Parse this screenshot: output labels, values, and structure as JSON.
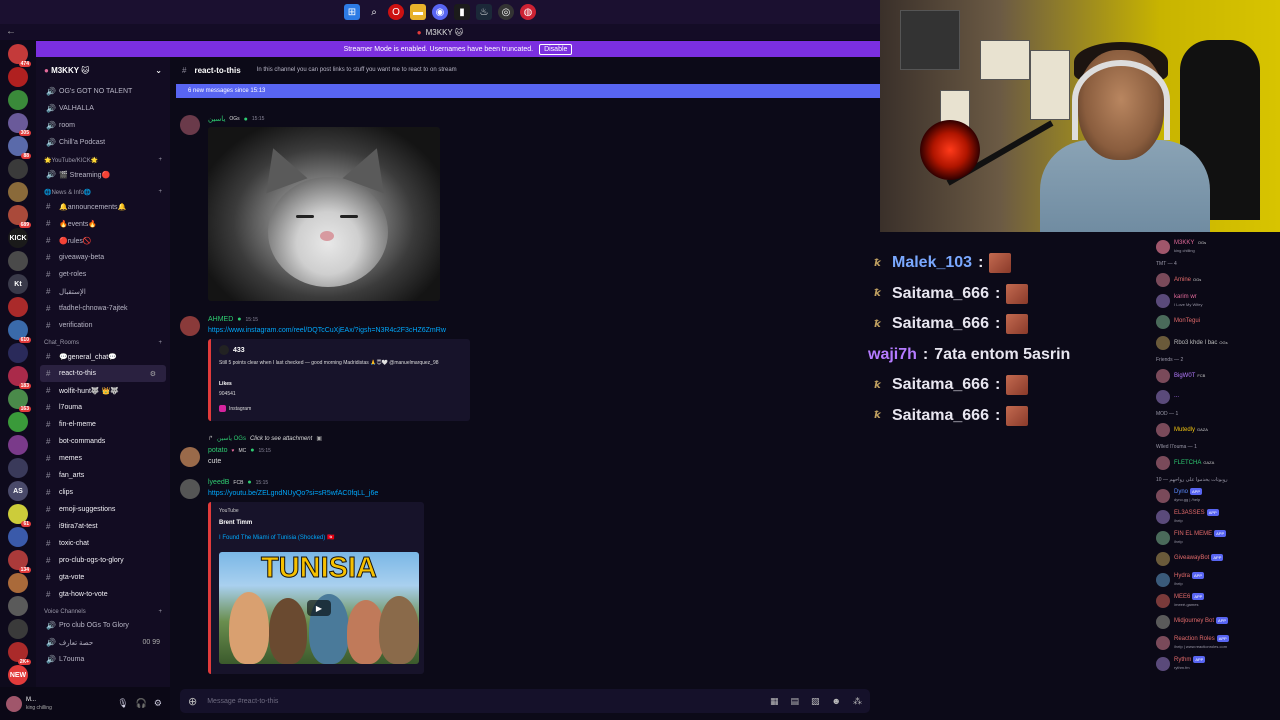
{
  "os_taskbar": {
    "icons": [
      "windows-icon",
      "search-icon",
      "opera-icon",
      "folder-icon",
      "discord-icon",
      "app-icon",
      "steam-icon",
      "app2-icon",
      "chrome-icon"
    ]
  },
  "window": {
    "title": "M3KKY 🐱"
  },
  "streamer_banner": {
    "text": "Streamer Mode is enabled. Usernames have been truncated.",
    "button": "Disable"
  },
  "server_rail": {
    "servers": [
      {
        "badge": "474",
        "color": "#c43a3a"
      },
      {
        "badge": "",
        "color": "#b02020"
      },
      {
        "badge": "",
        "color": "#3a8a3a"
      },
      {
        "badge": "305",
        "color": "#6a5a9a"
      },
      {
        "badge": "88",
        "color": "#5a6aaa"
      },
      {
        "badge": "",
        "color": "#3a3a3a"
      },
      {
        "badge": "",
        "color": "#8a6a3a"
      },
      {
        "badge": "689",
        "color": "#aa4a3a"
      },
      {
        "badge": "",
        "color": "#1a1a1a",
        "text": "KICK"
      },
      {
        "badge": "",
        "color": "#4a4a4a"
      },
      {
        "badge": "",
        "color": "#3a3a4a",
        "text": "Kt"
      },
      {
        "badge": "",
        "color": "#aa2a2a"
      },
      {
        "badge": "610",
        "color": "#3a6aaa"
      },
      {
        "badge": "",
        "color": "#2a2a5a"
      },
      {
        "badge": "183",
        "color": "#aa2a4a"
      },
      {
        "badge": "163",
        "color": "#4a8a4a"
      },
      {
        "badge": "",
        "color": "#3a9a3a"
      },
      {
        "badge": "",
        "color": "#7a3a8a"
      },
      {
        "badge": "",
        "color": "#3a3a5a"
      },
      {
        "badge": "",
        "color": "#4a4a6a",
        "text": "AS"
      },
      {
        "badge": "61",
        "color": "#cccc3a"
      },
      {
        "badge": "",
        "color": "#3a5aaa"
      },
      {
        "badge": "134",
        "color": "#aa3a3a"
      },
      {
        "badge": "",
        "color": "#aa6a3a"
      },
      {
        "badge": "",
        "color": "#5a5a5a"
      },
      {
        "badge": "",
        "color": "#3a3a3a"
      },
      {
        "badge": "2K+",
        "color": "#aa2a2a"
      },
      {
        "badge": "",
        "color": "#e23b3b",
        "text": "NEW"
      }
    ]
  },
  "channels": {
    "server_name": "M3KKY 🐱",
    "top": [
      "OG's GOT NO TALENT",
      "VALHALLA",
      "room",
      "Chill'a Podcast"
    ],
    "cat_youtube": "🌟YouTube/KICK🌟",
    "youtube": [
      "🎬 Streaming🔴"
    ],
    "cat_news": "🌐News & Info🌐",
    "news": [
      "🔔announcements🔔",
      "🔥events🔥",
      "🔴rules🚫",
      "giveaway-beta",
      "get-roles",
      "الإستقبال",
      "tfadhel-chnowa-7ajtek",
      "verification"
    ],
    "cat_chat": "Chat_Rooms",
    "chat": [
      "💬general_chat💬",
      "react-to-this",
      "wolfit-hunt🐺 👑🐺",
      "l7ouma",
      "fin-el-meme",
      "bot-commands",
      "memes",
      "fan_arts",
      "clips",
      "emoji-suggestions",
      "i9tira7at-test",
      "toxic-chat",
      "pro-club-ogs-to-glory",
      "gta-vote",
      "gta-how-to-vote"
    ],
    "cat_voice": "Voice Channels",
    "voice": [
      {
        "name": "Pro club OGs To Glory",
        "extra": ""
      },
      {
        "name": "حصة تعارف",
        "extra": "00 99"
      },
      {
        "name": "L7ouma",
        "extra": ""
      }
    ]
  },
  "user": {
    "name": "M...",
    "status": "king chilling"
  },
  "chat_header": {
    "channel": "react-to-this",
    "topic": "In this channel you can post links to stuff you want me to react to on stream"
  },
  "new_messages": "6 new messages since 15:13",
  "messages": [
    {
      "author": "ياسين",
      "tag": "OGs",
      "time": "15:15",
      "color": "#2ecc71"
    },
    {
      "author": "AHMED",
      "time": "15:15",
      "link": "https://www.instagram.com/reel/DQTcCuXjEAx/?igsh=N3R4c2F3cHZ6ZmRw",
      "embed": {
        "title": "433",
        "desc": "Still 5 points clear when I last checked — good morning Madridistas 🙏😇🤍 @manuelmarquez_98",
        "likes_label": "Likes",
        "likes": "904541",
        "footer": "Instagram"
      }
    },
    {
      "reply_to": "ياسين OGs",
      "reply_text": "Click to see attachment",
      "author": "potato",
      "tag": "MC",
      "time": "15:15",
      "text": "cute"
    },
    {
      "author": "lyeedB",
      "tag": "FCB",
      "time": "15:15",
      "link": "https://youtu.be/ZELgndNUyQo?si=sR5wfAC0fqLL_j6e",
      "embed": {
        "provider": "YouTube",
        "channel": "Brent Timm",
        "title": "I Found The Miami of Tunisia (Shocked) 🇹🇳",
        "thumb_text": "TUNISIA"
      }
    }
  ],
  "input": {
    "placeholder": "Message #react-to-this"
  },
  "stream_chat": [
    {
      "user": "Malek_103",
      "sep": ":",
      "color": "#7aa8ff",
      "emote": true,
      "text": ""
    },
    {
      "user": "Saitama_666",
      "sep": ":",
      "color": "#e8e6f0",
      "emote": true,
      "text": ""
    },
    {
      "user": "Saitama_666",
      "sep": ":",
      "color": "#e8e6f0",
      "emote": true,
      "text": ""
    },
    {
      "user": "waji7h",
      "sep": ":",
      "color": "#b57bff",
      "emote": false,
      "text": "7ata entom 5asrin"
    },
    {
      "user": "Saitama_666",
      "sep": ":",
      "color": "#e8e6f0",
      "emote": true,
      "text": ""
    },
    {
      "user": "Saitama_666",
      "sep": ":",
      "color": "#e8e6f0",
      "emote": true,
      "text": ""
    }
  ],
  "members": {
    "top": {
      "name": "M3KKY",
      "tag": "OGs",
      "status": "king chilling"
    },
    "cat_tmt": "TMT — 4",
    "tmt": [
      {
        "name": "Amine",
        "color": "#e26a6a",
        "tag": "OGs",
        "sub": ""
      },
      {
        "name": "karim wr",
        "color": "#e26a9a",
        "tag": "",
        "sub": "I Love My Wifey"
      },
      {
        "name": "MonTegui",
        "color": "#e26a6a",
        "tag": "",
        "sub": ""
      },
      {
        "name": "Rbo3 khde l bac",
        "color": "#bbbbbb",
        "tag": "OGs",
        "sub": ""
      }
    ],
    "cat_friends": "Friends — 2",
    "friends": [
      {
        "name": "BigW0T",
        "color": "#b57bff",
        "tag": "FCB"
      },
      {
        "name": "...",
        "color": "#b57bff",
        "tag": ""
      }
    ],
    "cat_mod": "MOD — 1",
    "mod": [
      {
        "name": "Mutedly",
        "color": "#f1c40f",
        "tag": "GAZA"
      }
    ],
    "cat_ouled": "Wlled l7ouma — 1",
    "ouled": [
      {
        "name": "FLETCHA",
        "color": "#2ecc71",
        "tag": "GAZA"
      }
    ],
    "cat_bots": "روبوتات يخدموا على رواحهم — 10",
    "bots": [
      {
        "name": "Dyno",
        "color": "#5b8bff",
        "sub": "dyno.gg | /help"
      },
      {
        "name": "EL3ASSES",
        "color": "#e26a6a",
        "sub": "/help"
      },
      {
        "name": "FIN EL MEME",
        "color": "#e26a6a",
        "sub": "/help"
      },
      {
        "name": "GiveawayBot",
        "color": "#e26a6a",
        "sub": ""
      },
      {
        "name": "Hydra",
        "color": "#e26a6a",
        "sub": "/help"
      },
      {
        "name": "MEE6",
        "color": "#e26a6a",
        "sub": "/meeé-games"
      },
      {
        "name": "Midjourney Bot",
        "color": "#e26a6a",
        "sub": ""
      },
      {
        "name": "Reaction Roles",
        "color": "#e26a6a",
        "sub": "/help | www.reactionroles.com"
      },
      {
        "name": "Rythm",
        "color": "#e26a6a",
        "sub": "rythm.fm"
      }
    ],
    "app_label": "APP"
  }
}
